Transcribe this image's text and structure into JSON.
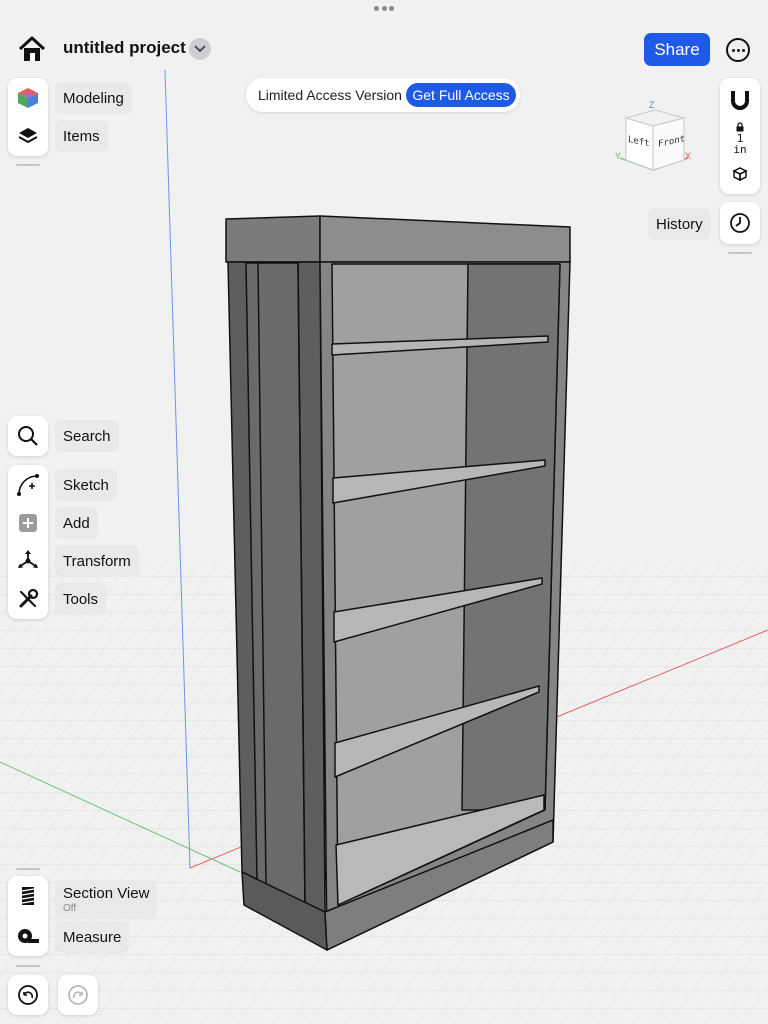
{
  "header": {
    "project_title": "untitled project",
    "share_label": "Share"
  },
  "access_banner": {
    "text": "Limited Access Version",
    "button_label": "Get Full Access"
  },
  "left_top_tools": {
    "modeling_label": "Modeling",
    "items_label": "Items"
  },
  "left_mid_tools": {
    "search_label": "Search",
    "sketch_label": "Sketch",
    "add_label": "Add",
    "transform_label": "Transform",
    "tools_label": "Tools"
  },
  "left_bottom_tools": {
    "section_view_label": "Section View",
    "section_view_state": "Off",
    "measure_label": "Measure"
  },
  "right_tools": {
    "history_label": "History",
    "unit_value": "1",
    "unit_label": "in"
  },
  "view_cube": {
    "left_face": "Left",
    "front_face": "Front",
    "axis_z": "Z",
    "axis_x": "X",
    "axis_y": "Y"
  },
  "colors": {
    "accent": "#1f5ae6",
    "grid": "#dcdcdf",
    "axis_red": "#e05a5a",
    "axis_green": "#5cb86a",
    "axis_blue": "#5a86e0"
  }
}
